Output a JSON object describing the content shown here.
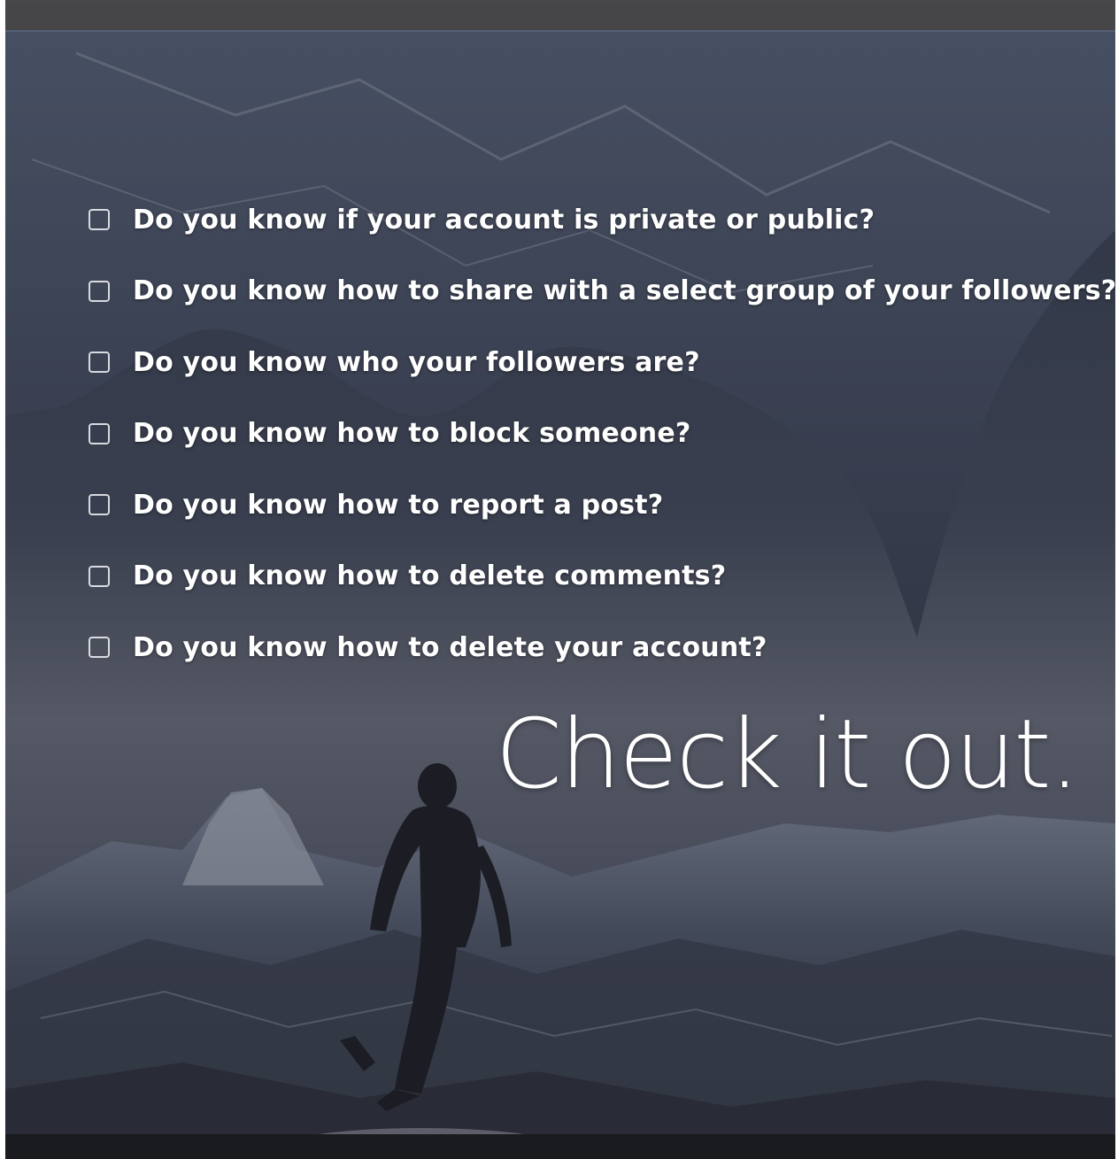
{
  "checklist": [
    {
      "text": "Do you know if your account is private or public?"
    },
    {
      "text": "Do you know how to share with a select group of your followers?"
    },
    {
      "text": "Do you know who your followers are?"
    },
    {
      "text": "Do you know how to block someone?"
    },
    {
      "text": "Do you know how to report a post?"
    },
    {
      "text": "Do you know how to delete comments?"
    },
    {
      "text": "Do you know how to delete your account?"
    }
  ],
  "headline": "Check it out.",
  "colors": {
    "text": "#ffffff",
    "overlay": "#323440",
    "sky": "#2c3140",
    "mountain": "#4a5468",
    "snow": "#c9ced8"
  }
}
